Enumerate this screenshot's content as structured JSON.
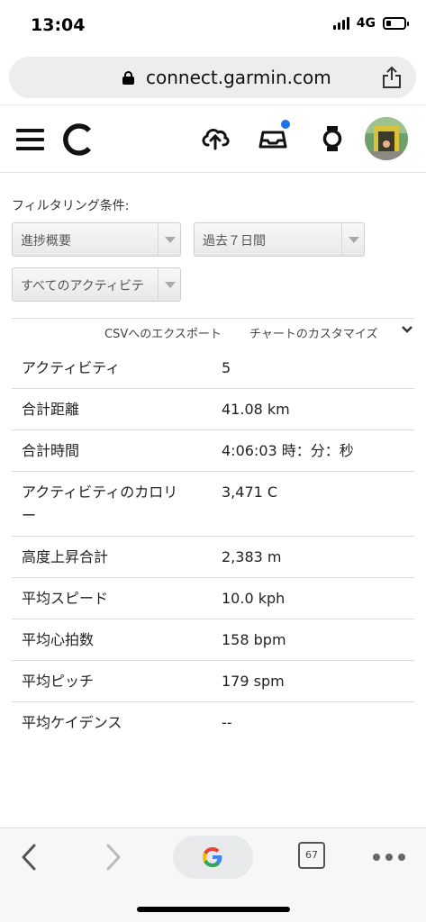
{
  "status_bar": {
    "time": "13:04",
    "network": "4G",
    "battery_level": 0.3
  },
  "browser": {
    "url": "connect.garmin.com",
    "tabs_count": "67"
  },
  "header": {
    "icons": [
      "hamburger-menu-icon",
      "garmin-logo",
      "upload-icon",
      "inbox-icon",
      "watch-icon",
      "avatar"
    ],
    "notification_color": "#1a73e8"
  },
  "filters": {
    "label": "フィルタリング条件:",
    "report_type": "進捗概要",
    "period": "過去７日間",
    "activity_type": "すべてのアクティビテ"
  },
  "actions": {
    "export": "CSVへのエクスポート",
    "customize": "チャートのカスタマイズ"
  },
  "stats": [
    {
      "label": "アクティビティ",
      "value": "5"
    },
    {
      "label": "合計距離",
      "value": "41.08 km"
    },
    {
      "label": "合計時間",
      "value": "4:06:03 時：分：秒"
    },
    {
      "label": "アクティビティのカロリ",
      "label2": "ー",
      "value": "3,471 C"
    },
    {
      "label": "高度上昇合計",
      "value": "2,383 m"
    },
    {
      "label": "平均スピード",
      "value": "10.0 kph"
    },
    {
      "label": "平均心拍数",
      "value": "158 bpm"
    },
    {
      "label": "平均ピッチ",
      "value": "179 spm"
    },
    {
      "label": "平均ケイデンス",
      "value": "--"
    }
  ]
}
